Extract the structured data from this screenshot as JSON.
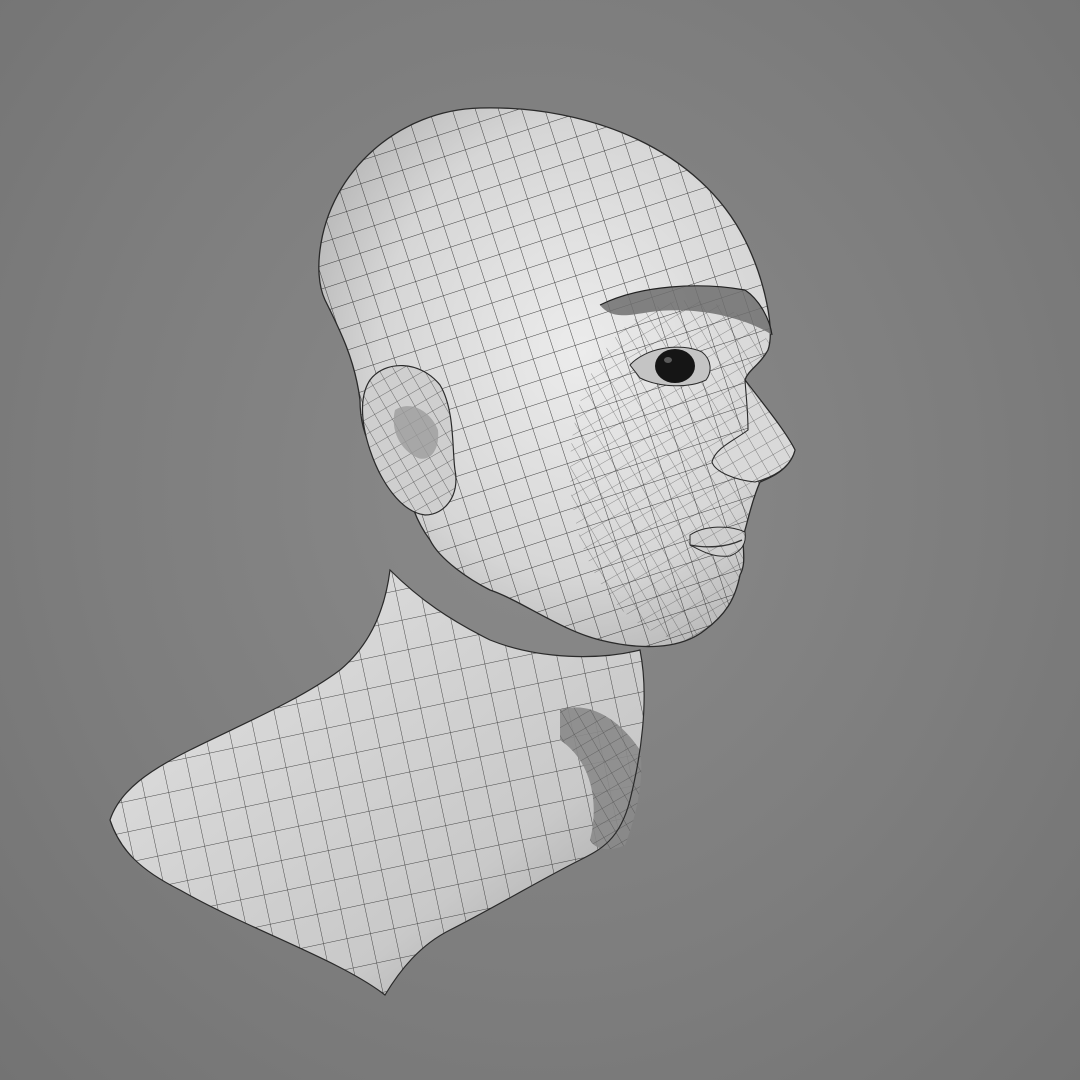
{
  "viewport": {
    "background_color": "#7f7f7f",
    "mesh_surface_color": "#dcdcdc",
    "mesh_wire_color": "#1e1e1e",
    "mesh_shadow_color": "#8f8f8f"
  },
  "subject": {
    "type": "3d-wireframe-head-bust",
    "features": [
      "skull",
      "ear",
      "brow",
      "eye",
      "nose",
      "lips",
      "chin",
      "neck",
      "shoulders"
    ]
  }
}
